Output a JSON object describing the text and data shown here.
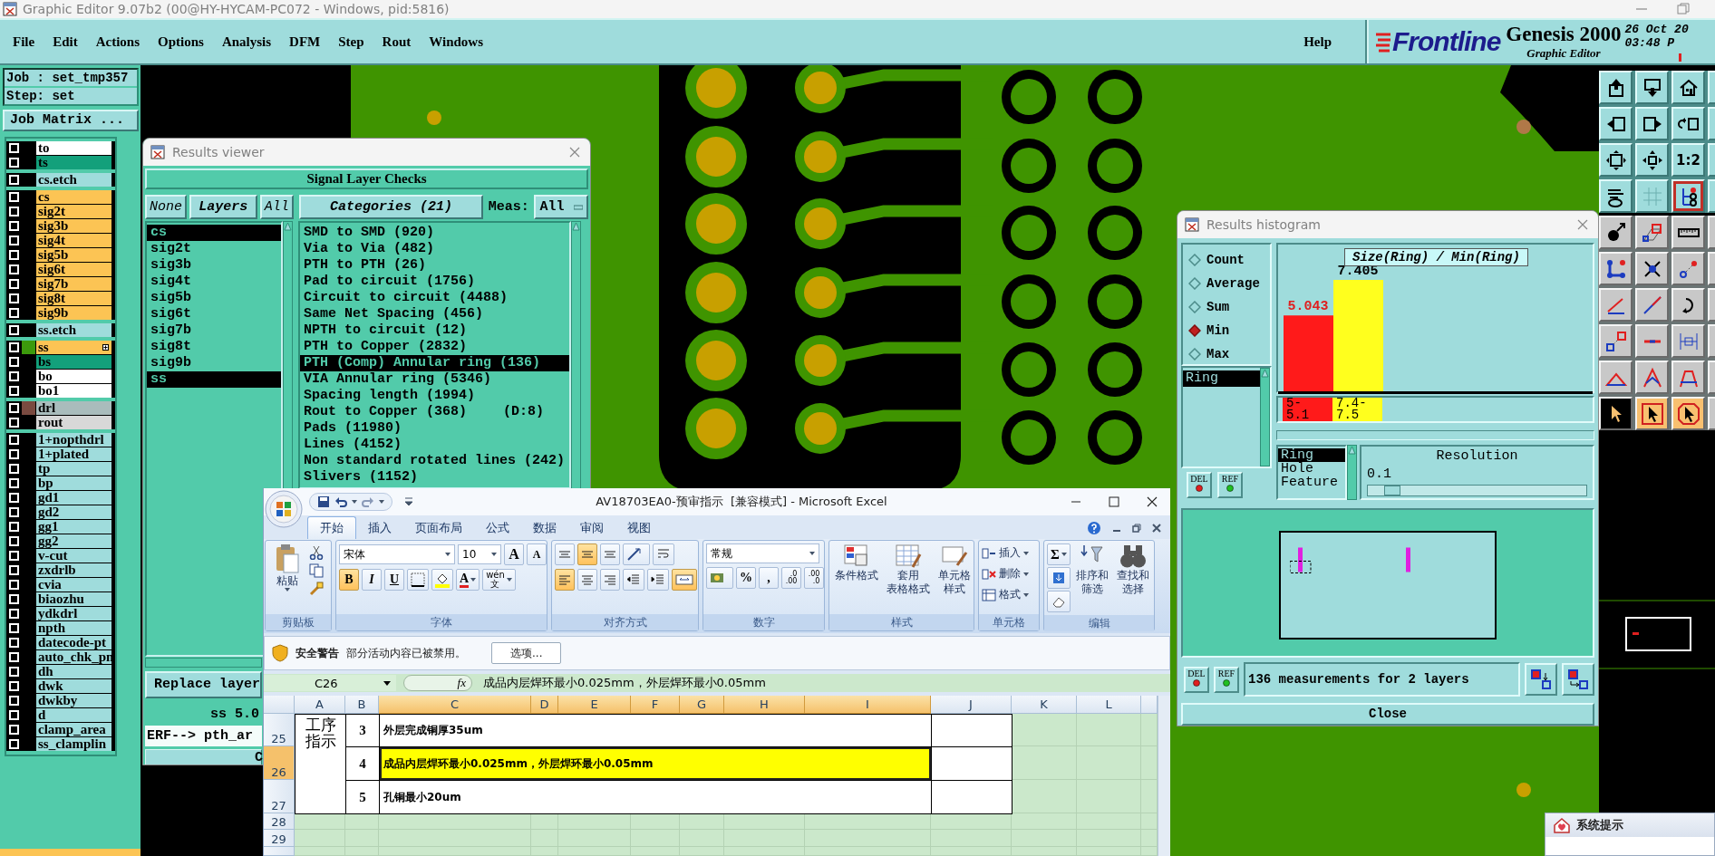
{
  "window": {
    "title": "Graphic Editor 9.07b2 (00@HY-HYCAM-PC072 - Windows, pid:5816)"
  },
  "menu": [
    "File",
    "Edit",
    "Actions",
    "Options",
    "Analysis",
    "DFM",
    "Step",
    "Rout",
    "Windows"
  ],
  "help": "Help",
  "brand": {
    "logo": "Frontline",
    "product": "Genesis 2000",
    "subtitle": "Graphic Editor",
    "date": "26 Oct 20",
    "time": "03:48 P"
  },
  "job": {
    "job": "Job : set_tmp357",
    "step": "Step: set",
    "matrix_button": "Job Matrix ..."
  },
  "layer_groups": [
    [
      {
        "name": "to",
        "checked": false,
        "work_layer": false,
        "color": "#ffffff"
      },
      {
        "name": "ts",
        "checked": false,
        "work_layer": false,
        "color": "#13a07b"
      }
    ],
    [
      {
        "name": "cs.etch",
        "checked": false,
        "work_layer": false,
        "color": "#9fdcdc"
      }
    ],
    [
      {
        "name": "cs",
        "checked": false,
        "work_layer": false,
        "color": "#fcc454"
      },
      {
        "name": "sig2t",
        "checked": false,
        "work_layer": false,
        "color": "#fcc454"
      },
      {
        "name": "sig3b",
        "checked": false,
        "work_layer": false,
        "color": "#fcc454"
      },
      {
        "name": "sig4t",
        "checked": false,
        "work_layer": false,
        "color": "#fcc454"
      },
      {
        "name": "sig5b",
        "checked": false,
        "work_layer": false,
        "color": "#fcc454"
      },
      {
        "name": "sig6t",
        "checked": false,
        "work_layer": false,
        "color": "#fcc454"
      },
      {
        "name": "sig7b",
        "checked": false,
        "work_layer": false,
        "color": "#fcc454"
      },
      {
        "name": "sig8t",
        "checked": false,
        "work_layer": false,
        "color": "#fcc454"
      },
      {
        "name": "sig9b",
        "checked": false,
        "work_layer": false,
        "color": "#fcc454"
      }
    ],
    [
      {
        "name": "ss.etch",
        "checked": false,
        "work_layer": false,
        "color": "#9fdcdc"
      }
    ],
    [
      {
        "name": "ss",
        "checked": false,
        "work_layer": true,
        "color": "#fcc454",
        "swatch": {
          "color": "#3c9a0c"
        }
      },
      {
        "name": "bs",
        "checked": false,
        "work_layer": false,
        "color": "#13a07b"
      },
      {
        "name": "bo",
        "checked": false,
        "work_layer": false,
        "color": "#ffffff"
      },
      {
        "name": "bo1",
        "checked": false,
        "work_layer": false,
        "color": "#ffffff"
      }
    ],
    [
      {
        "name": "drl",
        "checked": false,
        "work_layer": false,
        "color": "#a9bcbc",
        "swatch": {
          "color": "#7a4a40"
        }
      },
      {
        "name": "rout",
        "checked": false,
        "work_layer": false,
        "color": "#d8d8d8"
      }
    ],
    [
      {
        "name": "1+nopthdrl",
        "checked": false,
        "work_layer": false,
        "color": "#9fdcdc"
      },
      {
        "name": "1+plated",
        "checked": false,
        "work_layer": false,
        "color": "#9fdcdc"
      },
      {
        "name": "tp",
        "checked": false,
        "work_layer": false,
        "color": "#9fdcdc"
      },
      {
        "name": "bp",
        "checked": false,
        "work_layer": false,
        "color": "#9fdcdc"
      },
      {
        "name": "gd1",
        "checked": false,
        "work_layer": false,
        "color": "#9fdcdc"
      },
      {
        "name": "gd2",
        "checked": false,
        "work_layer": false,
        "color": "#9fdcdc"
      },
      {
        "name": "gg1",
        "checked": false,
        "work_layer": false,
        "color": "#9fdcdc"
      },
      {
        "name": "gg2",
        "checked": false,
        "work_layer": false,
        "color": "#9fdcdc"
      },
      {
        "name": "v-cut",
        "checked": false,
        "work_layer": false,
        "color": "#9fdcdc"
      },
      {
        "name": "zxdrlb",
        "checked": false,
        "work_layer": false,
        "color": "#9fdcdc"
      },
      {
        "name": "cvia",
        "checked": false,
        "work_layer": false,
        "color": "#9fdcdc"
      },
      {
        "name": "biaozhu",
        "checked": false,
        "work_layer": false,
        "color": "#9fdcdc"
      },
      {
        "name": "ydkdrl",
        "checked": false,
        "work_layer": false,
        "color": "#9fdcdc"
      },
      {
        "name": "npth",
        "checked": false,
        "work_layer": false,
        "color": "#9fdcdc"
      },
      {
        "name": "datecode-pt",
        "checked": false,
        "work_layer": false,
        "color": "#9fdcdc"
      },
      {
        "name": "auto_chk_pn",
        "checked": false,
        "work_layer": false,
        "color": "#9fdcdc"
      },
      {
        "name": "dh",
        "checked": false,
        "work_layer": false,
        "color": "#9fdcdc"
      },
      {
        "name": "dwk",
        "checked": false,
        "work_layer": false,
        "color": "#9fdcdc"
      },
      {
        "name": "dwkby",
        "checked": false,
        "work_layer": false,
        "color": "#9fdcdc"
      },
      {
        "name": "d",
        "checked": false,
        "work_layer": false,
        "color": "#9fdcdc"
      },
      {
        "name": "clamp_area",
        "checked": false,
        "work_layer": false,
        "color": "#9fdcdc"
      },
      {
        "name": "ss_clamplin",
        "checked": false,
        "work_layer": false,
        "color": "#9fdcdc"
      }
    ]
  ],
  "palette": {
    "zoom_label": "1:2"
  },
  "results_viewer": {
    "title": "Results viewer",
    "header": "Signal Layer Checks",
    "none_button": "None",
    "layers_button": "Layers",
    "all_button": "All",
    "categories_button": "Categories (21)",
    "meas_label": "Meas:",
    "meas_value": "All",
    "layers": [
      {
        "name": "cs",
        "selected": true
      },
      {
        "name": "sig2t",
        "selected": false
      },
      {
        "name": "sig3b",
        "selected": false
      },
      {
        "name": "sig4t",
        "selected": false
      },
      {
        "name": "sig5b",
        "selected": false
      },
      {
        "name": "sig6t",
        "selected": false
      },
      {
        "name": "sig7b",
        "selected": false
      },
      {
        "name": "sig8t",
        "selected": false
      },
      {
        "name": "sig9b",
        "selected": false
      },
      {
        "name": "ss",
        "selected": true
      }
    ],
    "categories": [
      {
        "label": "SMD to SMD (920)",
        "selected": false
      },
      {
        "label": "Via to Via (482)",
        "selected": false
      },
      {
        "label": "PTH to PTH (26)",
        "selected": false
      },
      {
        "label": "Pad to circuit (1756)",
        "selected": false
      },
      {
        "label": "Circuit to circuit (4488)",
        "selected": false
      },
      {
        "label": "Same Net Spacing (456)",
        "selected": false
      },
      {
        "label": "NPTH to circuit (12)",
        "selected": false
      },
      {
        "label": "PTH to Copper (2832)",
        "selected": false
      },
      {
        "label": "PTH (Comp) Annular ring (136)",
        "selected": true
      },
      {
        "label": "VIA Annular ring (5346)",
        "selected": false
      },
      {
        "label": "Spacing length (1994)",
        "selected": false
      },
      {
        "label": "Rout to Copper (368)",
        "note": "(D:8)",
        "selected": false
      },
      {
        "label": "Pads (11980)",
        "selected": false
      },
      {
        "label": "Lines (4152)",
        "selected": false
      },
      {
        "label": "Non standard rotated lines (242)",
        "selected": false
      },
      {
        "label": "Slivers (1152)",
        "selected": false
      }
    ],
    "replace_button": "Replace layer",
    "layer_line": "ss 5.0",
    "erf_line": "ERF--> pth_ar",
    "close_button": "C"
  },
  "histogram": {
    "title": "Results histogram",
    "modes": [
      {
        "label": "Count",
        "selected": false
      },
      {
        "label": "Average",
        "selected": false
      },
      {
        "label": "Sum",
        "selected": false
      },
      {
        "label": "Min",
        "selected": true
      },
      {
        "label": "Max",
        "selected": false
      }
    ],
    "fields": [
      {
        "label": "Ring",
        "selected": true
      }
    ],
    "list_buttons": [
      "DEL",
      "REF"
    ],
    "chart_data": {
      "type": "bar",
      "title": "Size(Ring) / Min(Ring)",
      "categories": [
        "5-5.1",
        "7.4-7.5"
      ],
      "values": [
        5.043,
        7.405
      ],
      "data_labels": true
    },
    "bins": [
      {
        "color": "#ff1a1a",
        "selected": true
      },
      {
        "color": "#ffff1e",
        "selected": false
      }
    ],
    "sources": [
      {
        "label": "Ring",
        "selected": true
      },
      {
        "label": "Hole",
        "selected": false
      },
      {
        "label": "Feature",
        "selected": false
      }
    ],
    "resolution_label": "Resolution",
    "resolution_value": "0.1",
    "resolution": {
      "level": 0.08
    },
    "status_buttons": [
      "DEL",
      "REF"
    ],
    "summary": "136 measurements for 2 layers",
    "close_button": "Close"
  },
  "excel": {
    "title": "AV18703EA0-预审指示  [兼容模式] - Microsoft Excel",
    "tabs": [
      {
        "label": "开始",
        "selected": true
      },
      {
        "label": "插入",
        "selected": false
      },
      {
        "label": "页面布局",
        "selected": false
      },
      {
        "label": "公式",
        "selected": false
      },
      {
        "label": "数据",
        "selected": false
      },
      {
        "label": "审阅",
        "selected": false
      },
      {
        "label": "视图",
        "selected": false
      }
    ],
    "ribbon": {
      "paste": "粘贴",
      "font_name": "宋体",
      "font_size": "10",
      "grow_font": "A",
      "shrink_font": "A",
      "format_buttons": [
        {
          "label": "B",
          "selected": true
        },
        {
          "label": "I",
          "selected": false
        },
        {
          "label": "U",
          "selected": false
        }
      ],
      "font_color": "A",
      "phonetic": [
        "wén",
        "文"
      ],
      "vertical_align": [
        {
          "selected": false
        },
        {
          "selected": true
        },
        {
          "selected": false
        }
      ],
      "horizontal_align": [
        {
          "selected": true
        },
        {
          "selected": false
        },
        {
          "selected": false
        }
      ],
      "merge": {
        "selected": true
      },
      "number_format": "常规",
      "percent": "%",
      "comma": ",",
      "decimal_buttons": [
        [
          ".0",
          ".00"
        ],
        [
          ".00",
          ".0"
        ]
      ],
      "styles": [
        [
          "条件格式"
        ],
        [
          "套用",
          "表格格式"
        ],
        [
          "单元格",
          "样式"
        ]
      ],
      "cells": [
        "插入",
        "删除",
        "格式"
      ],
      "sum": "Σ",
      "editing": [
        [
          "排序和",
          "筛选"
        ],
        [
          "查找和",
          "选择"
        ]
      ],
      "groups": [
        "剪贴板",
        "字体",
        "对齐方式",
        "数字",
        "样式",
        "单元格",
        "编辑"
      ]
    },
    "security": {
      "title": "安全警告",
      "message": "部分活动内容已被禁用。",
      "button": "选项..."
    },
    "name_box": "C26",
    "function_label": "fx",
    "formula": "成品内层焊环最小0.025mm，外层焊环最小0.05mm",
    "columns": [
      {
        "label": "A",
        "selected": false
      },
      {
        "label": "B",
        "selected": false
      },
      {
        "label": "C",
        "selected": true
      },
      {
        "label": "D",
        "selected": true
      },
      {
        "label": "E",
        "selected": true
      },
      {
        "label": "F",
        "selected": true
      },
      {
        "label": "G",
        "selected": true
      },
      {
        "label": "H",
        "selected": true
      },
      {
        "label": "I",
        "selected": true
      },
      {
        "label": "J",
        "selected": false
      },
      {
        "label": "K",
        "selected": false
      },
      {
        "label": "L",
        "selected": false
      }
    ],
    "rows": [
      {
        "number": "25",
        "selected": false
      },
      {
        "number": "26",
        "selected": true
      },
      {
        "number": "27",
        "selected": false
      },
      {
        "number": "28",
        "selected": false
      },
      {
        "number": "29",
        "selected": false
      }
    ],
    "section_label": "工序指示",
    "items": [
      {
        "number": "3",
        "text": "外层完成铜厚35um",
        "highlighted": false
      },
      {
        "number": "4",
        "text": "成品内层焊环最小0.025mm，外层焊环最小0.05mm",
        "highlighted": true
      },
      {
        "number": "5",
        "text": "孔铜最小20um",
        "highlighted": false
      }
    ]
  },
  "system_prompt": {
    "title": "系统提示"
  }
}
